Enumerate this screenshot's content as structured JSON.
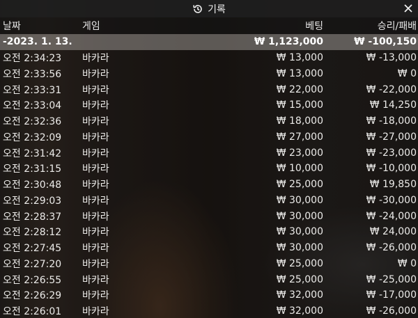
{
  "window": {
    "title": "기록"
  },
  "columns": {
    "date": "날짜",
    "game": "게임",
    "bet": "베팅",
    "win_loss": "승리/패배"
  },
  "summary": {
    "date": "-2023. 1. 13.",
    "game": "",
    "bet": "₩ 1,123,000",
    "win_loss": "₩ -100,150"
  },
  "rows": [
    {
      "time": "오전 2:34:23",
      "game": "바카라",
      "bet": "₩ 13,000",
      "win_loss": "₩ -13,000"
    },
    {
      "time": "오전 2:33:56",
      "game": "바카라",
      "bet": "₩ 13,000",
      "win_loss": "₩ 0"
    },
    {
      "time": "오전 2:33:31",
      "game": "바카라",
      "bet": "₩ 22,000",
      "win_loss": "₩ -22,000"
    },
    {
      "time": "오전 2:33:04",
      "game": "바카라",
      "bet": "₩ 15,000",
      "win_loss": "₩ 14,250"
    },
    {
      "time": "오전 2:32:36",
      "game": "바카라",
      "bet": "₩ 18,000",
      "win_loss": "₩ -18,000"
    },
    {
      "time": "오전 2:32:09",
      "game": "바카라",
      "bet": "₩ 27,000",
      "win_loss": "₩ -27,000"
    },
    {
      "time": "오전 2:31:42",
      "game": "바카라",
      "bet": "₩ 23,000",
      "win_loss": "₩ -23,000"
    },
    {
      "time": "오전 2:31:15",
      "game": "바카라",
      "bet": "₩ 10,000",
      "win_loss": "₩ -10,000"
    },
    {
      "time": "오전 2:30:48",
      "game": "바카라",
      "bet": "₩ 25,000",
      "win_loss": "₩ 19,850"
    },
    {
      "time": "오전 2:29:03",
      "game": "바카라",
      "bet": "₩ 30,000",
      "win_loss": "₩ -30,000"
    },
    {
      "time": "오전 2:28:37",
      "game": "바카라",
      "bet": "₩ 30,000",
      "win_loss": "₩ -24,000"
    },
    {
      "time": "오전 2:28:12",
      "game": "바카라",
      "bet": "₩ 30,000",
      "win_loss": "₩ 24,000"
    },
    {
      "time": "오전 2:27:45",
      "game": "바카라",
      "bet": "₩ 30,000",
      "win_loss": "₩ -26,000"
    },
    {
      "time": "오전 2:27:20",
      "game": "바카라",
      "bet": "₩ 25,000",
      "win_loss": "₩ 0"
    },
    {
      "time": "오전 2:26:55",
      "game": "바카라",
      "bet": "₩ 25,000",
      "win_loss": "₩ -25,000"
    },
    {
      "time": "오전 2:26:29",
      "game": "바카라",
      "bet": "₩ 32,000",
      "win_loss": "₩ -17,000"
    },
    {
      "time": "오전 2:26:01",
      "game": "바카라",
      "bet": "₩ 32,000",
      "win_loss": "₩ -26,000"
    }
  ]
}
